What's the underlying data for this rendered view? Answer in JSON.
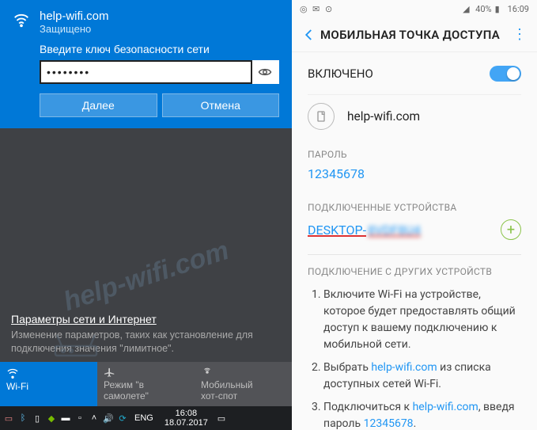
{
  "windows": {
    "ssid": "help-wifi.com",
    "status": "Защищено",
    "prompt": "Введите ключ безопасности сети",
    "password_value": "••••••••",
    "btn_next": "Далее",
    "btn_cancel": "Отмена",
    "watermark": "help-wifi.com",
    "net_settings_link": "Параметры сети и Интернет",
    "net_settings_desc": "Изменение параметров, таких как установление для подключения значения \"лимитное\".",
    "tiles": {
      "wifi": "Wi-Fi",
      "airplane1": "Режим \"в",
      "airplane2": "самолете\"",
      "hotspot1": "Мобильный",
      "hotspot2": "хот-спот"
    },
    "taskbar": {
      "lang": "ENG",
      "time": "16:08",
      "date": "18.07.2017"
    }
  },
  "android": {
    "statusbar": {
      "battery": "40%",
      "time": "16:09"
    },
    "title": "МОБИЛЬНАЯ ТОЧКА ДОСТУПА",
    "enabled_label": "ВКЛЮЧЕНО",
    "ssid": "help-wifi.com",
    "password_label": "ПАРОЛЬ",
    "password_value": "12345678",
    "devices_label": "ПОДКЛЮЧЕННЫЕ УСТРОЙСТВА",
    "device_prefix": "DESKTOP-",
    "device_masked": "8VDF8U4",
    "other_label": "ПОДКЛЮЧЕНИЕ С ДРУГИХ УСТРОЙСТВ",
    "steps": {
      "s1a": "Включите Wi-Fi на устройстве, которое будет предоставлять общий доступ к вашему подключению к мобильной сети.",
      "s2a": "Выбрать ",
      "s2b": "help-wifi.com",
      "s2c": " из списка доступных сетей Wi-Fi.",
      "s3a": "Подключиться к ",
      "s3b": "help-wifi.com",
      "s3c": ", введя пароль ",
      "s3d": "12345678",
      "s3e": "."
    }
  }
}
